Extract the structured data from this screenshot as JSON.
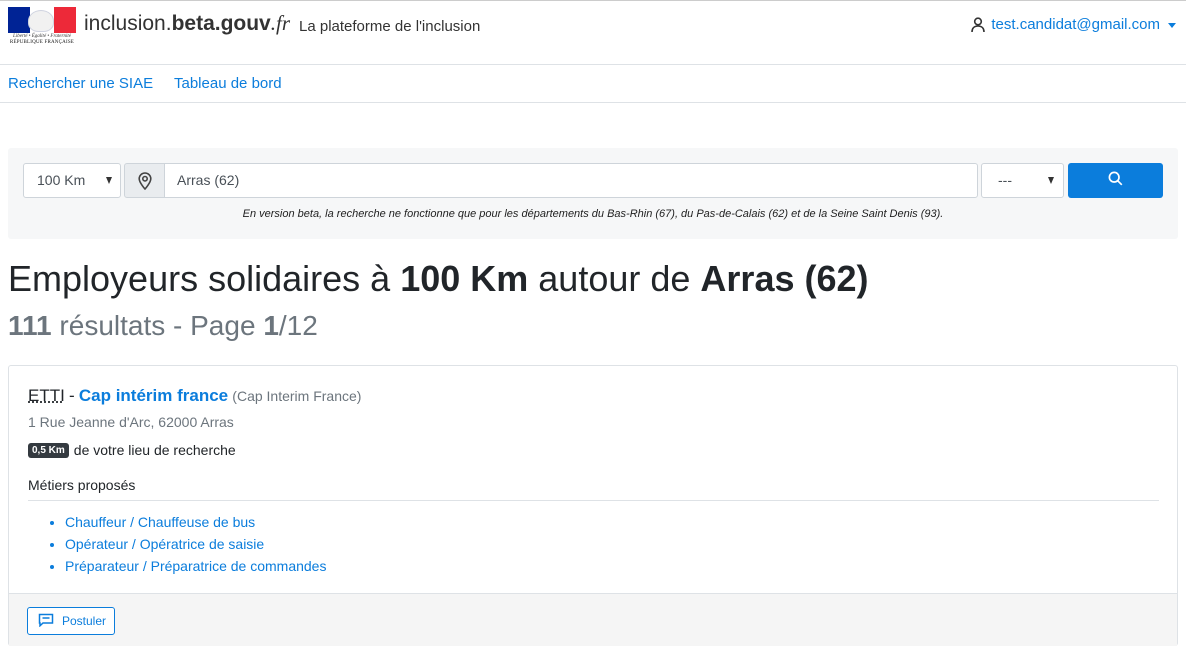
{
  "logo": {
    "motto": "Liberté • Égalité • Fraternité",
    "republic": "RÉPUBLIQUE FRANÇAISE"
  },
  "header": {
    "brand_plain": "inclusion.",
    "brand_bold": "beta.gouv",
    "brand_italic": ".fr",
    "tagline": "La plateforme de l'inclusion",
    "user_email": "test.candidat@gmail.com"
  },
  "nav": {
    "items": [
      {
        "label": "Rechercher une SIAE"
      },
      {
        "label": "Tableau de bord"
      }
    ]
  },
  "search": {
    "distance_value": "100 Km",
    "city_value": "Arras (62)",
    "kind_value": "---",
    "note": "En version beta, la recherche ne fonctionne que pour les départements du Bas-Rhin (67), du Pas-de-Calais (62) et de la Seine Saint Denis (93)."
  },
  "heading": {
    "prefix": "Employeurs solidaires à",
    "distance": "100 Km",
    "middle": "autour de",
    "city": "Arras (62)"
  },
  "results": {
    "count": "111",
    "label": "résultats - Page",
    "page": "1",
    "total_pages": "/12"
  },
  "card": {
    "kind": "ETTI",
    "separator": "-",
    "name": "Cap intérim france",
    "brand": "(Cap Interim France)",
    "address": "1 Rue Jeanne d'Arc, 62000 Arras",
    "distance_badge": "0,5 Km",
    "distance_text": "de votre lieu de recherche",
    "jobs_title": "Métiers proposés",
    "jobs": [
      "Chauffeur / Chauffeuse de bus",
      "Opérateur / Opératrice de saisie",
      "Préparateur / Préparatrice de commandes"
    ],
    "apply_label": "Postuler"
  },
  "colors": {
    "link": "#0b7ddc",
    "primary_button": "#0b7ddc",
    "badge": "#343a40",
    "muted_text": "#6c757d"
  },
  "icons": {
    "user": "user-icon",
    "location": "location-pin-icon",
    "search": "search-icon",
    "apply": "chat-bubble-icon"
  }
}
